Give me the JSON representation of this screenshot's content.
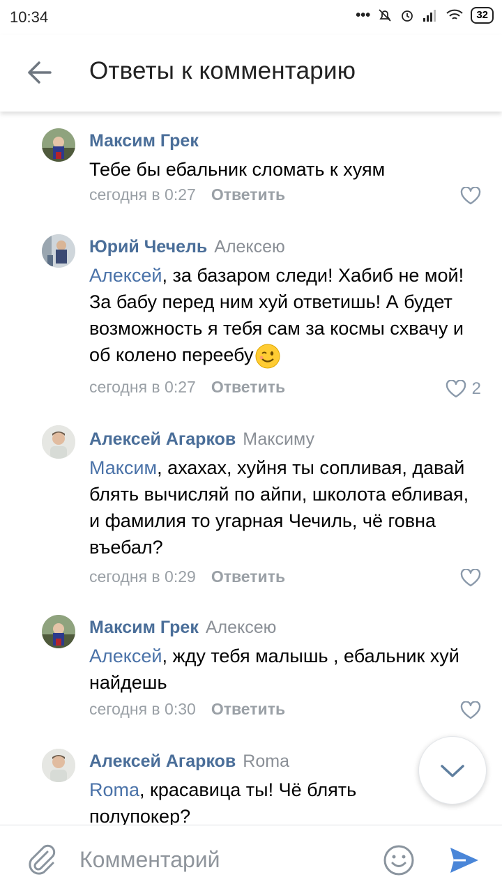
{
  "status_bar": {
    "time": "10:34",
    "battery": "32"
  },
  "header": {
    "title": "Ответы к комментарию"
  },
  "comments": [
    {
      "author": "Максим Грек",
      "reply_to": "",
      "mention": "",
      "text": "Тебе бы ебальник сломать к хуям",
      "time": "сегодня в 0:27",
      "reply_label": "Ответить",
      "likes": ""
    },
    {
      "author": "Юрий Чечель",
      "reply_to": "Алексею",
      "mention": "Алексей",
      "text": ", за базаром следи! Хабиб не мой! За бабу перед ним хуй ответишь! А будет возможность я тебя сам за космы схвачу и об колено переебу",
      "time": "сегодня в 0:27",
      "reply_label": "Ответить",
      "likes": "2"
    },
    {
      "author": "Алексей Агарков",
      "reply_to": "Максиму",
      "mention": "Максим",
      "text": ", ахахах, хуйня ты сопливая, давай блять вычисляй по айпи, школота ебливая, и фамилия то угарная Чечиль, чё говна въебал?",
      "time": "сегодня в 0:29",
      "reply_label": "Ответить",
      "likes": ""
    },
    {
      "author": "Максим Грек",
      "reply_to": "Алексею",
      "mention": "Алексей",
      "text": ", жду тебя малышь , ебальник хуй найдешь",
      "time": "сегодня в 0:30",
      "reply_label": "Ответить",
      "likes": ""
    },
    {
      "author": "Алексей Агарков",
      "reply_to": "Roma",
      "mention": "Roma",
      "text": ", красавица ты! Чё блять полупокер?",
      "time": "",
      "reply_label": "",
      "likes": ""
    }
  ],
  "composer": {
    "placeholder": "Комментарий"
  },
  "icons": {
    "back": "arrow-left-icon",
    "like": "heart-icon",
    "attach": "paperclip-icon",
    "emoji": "smiley-icon",
    "send": "send-icon",
    "scroll_down": "chevron-down-icon"
  },
  "colors": {
    "author": "#4a6e99",
    "mention": "#4a72a8",
    "meta": "#9aa0a6",
    "send": "#4a86d8"
  }
}
